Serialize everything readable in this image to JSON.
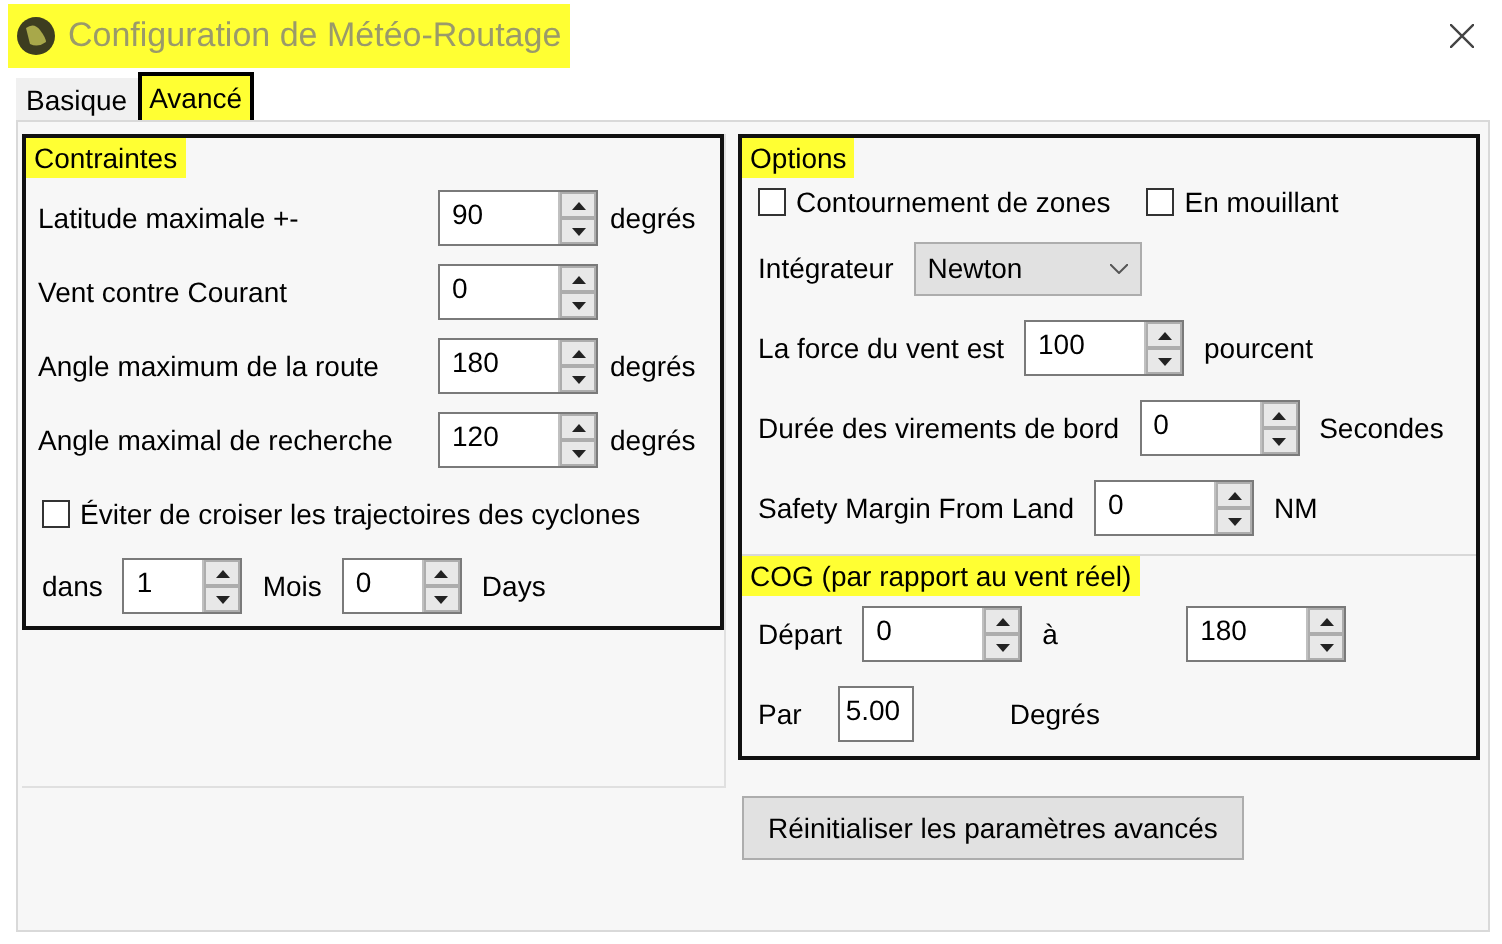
{
  "window": {
    "title": "Configuration de Météo-Routage",
    "highlighted": true
  },
  "tabs": [
    {
      "label": "Basique",
      "selected": false,
      "highlighted": false
    },
    {
      "label": "Avancé",
      "selected": true,
      "highlighted": true
    }
  ],
  "constraints": {
    "title": "Contraintes",
    "highlighted": true,
    "fields": [
      {
        "label": "Latitude maximale +-",
        "value": "90",
        "unit": "degrés"
      },
      {
        "label": "Vent contre Courant",
        "value": "0"
      },
      {
        "label": "Angle maximum de la route",
        "value": "180",
        "unit": "degrés"
      },
      {
        "label": "Angle maximal de recherche",
        "value": "120",
        "unit": "degrés"
      }
    ],
    "cyclones": {
      "label": "Éviter de croiser les trajectoires des cyclones",
      "checked": false
    },
    "period": {
      "label": "dans",
      "months_value": "1",
      "months_unit": "Mois",
      "days_value": "0",
      "days_unit": "Days"
    }
  },
  "options": {
    "title": "Options",
    "highlighted": true,
    "checkboxes": [
      {
        "label": "Contournement de zones",
        "checked": false
      },
      {
        "label": "En mouillant",
        "checked": false
      }
    ],
    "integrator": {
      "label": "Intégrateur",
      "value": "Newton"
    },
    "fields": [
      {
        "label": "La force du vent est",
        "value": "100",
        "unit": "pourcent"
      },
      {
        "label": "Durée des virements de bord",
        "value": "0",
        "unit": "Secondes"
      },
      {
        "label": "Safety Margin From Land",
        "value": "0",
        "unit": "NM"
      }
    ]
  },
  "cog": {
    "title": "COG (par rapport au vent réel)",
    "highlighted": true,
    "from": {
      "label": "Départ",
      "value": "0"
    },
    "to": {
      "label": "à",
      "value": "180"
    },
    "step": {
      "label": "Par",
      "value": "5.00",
      "unit": "Degrés"
    }
  },
  "reset_button": {
    "label": "Réinitialiser les paramètres avancés"
  }
}
